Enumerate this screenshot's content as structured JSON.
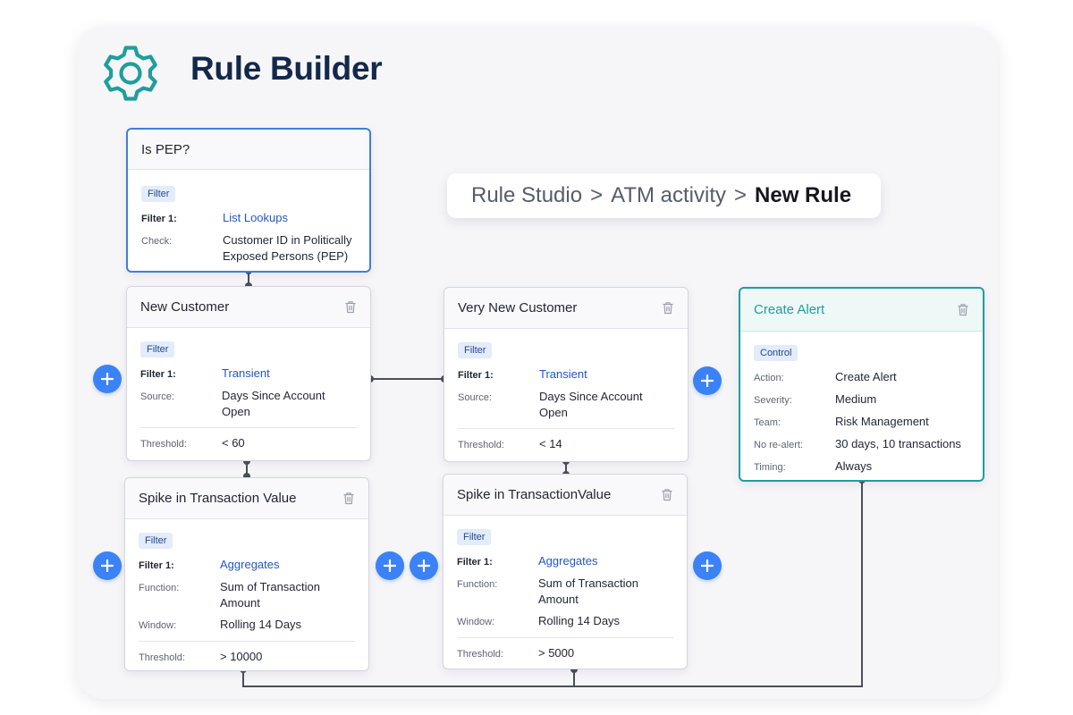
{
  "header": {
    "title": "Rule Builder",
    "icon": "gear-icon",
    "accent": "#1f9e9c"
  },
  "breadcrumb": {
    "items": [
      "Rule Studio",
      "ATM activity"
    ],
    "separator": ">",
    "current": "New Rule"
  },
  "cards": {
    "pep": {
      "title": "Is PEP?",
      "badge": "Filter",
      "rows": [
        {
          "label": "Filter 1:",
          "value": "List Lookups"
        },
        {
          "label": "Check:",
          "value": "Customer ID in Politically Exposed Persons (PEP)"
        }
      ]
    },
    "new_customer": {
      "title": "New Customer",
      "badge": "Filter",
      "rows": [
        {
          "label": "Filter 1:",
          "value": "Transient"
        },
        {
          "label": "Source:",
          "value": "Days Since Account Open"
        },
        {
          "label": "Threshold:",
          "value": "< 60"
        }
      ]
    },
    "spike_1": {
      "title": "Spike in Transaction Value",
      "badge": "Filter",
      "rows": [
        {
          "label": "Filter 1:",
          "value": "Aggregates"
        },
        {
          "label": "Function:",
          "value": "Sum of Transaction Amount"
        },
        {
          "label": "Window:",
          "value": "Rolling 14 Days"
        },
        {
          "label": "Threshold:",
          "value": "> 10000"
        }
      ]
    },
    "very_new_customer": {
      "title": "Very New Customer",
      "badge": "Filter",
      "rows": [
        {
          "label": "Filter 1:",
          "value": "Transient"
        },
        {
          "label": "Source:",
          "value": "Days Since Account Open"
        },
        {
          "label": "Threshold:",
          "value": "< 14"
        }
      ]
    },
    "spike_2": {
      "title": "Spike in TransactionValue",
      "badge": "Filter",
      "rows": [
        {
          "label": "Filter 1:",
          "value": "Aggregates"
        },
        {
          "label": "Function:",
          "value": "Sum of Transaction Amount"
        },
        {
          "label": "Window:",
          "value": "Rolling 14 Days"
        },
        {
          "label": "Threshold:",
          "value": "> 5000"
        }
      ]
    },
    "create_alert": {
      "title": "Create Alert",
      "badge": "Control",
      "rows": [
        {
          "label": "Action:",
          "value": "Create Alert"
        },
        {
          "label": "Severity:",
          "value": "Medium"
        },
        {
          "label": "Team:",
          "value": "Risk Management"
        },
        {
          "label": "No re-alert:",
          "value": "30 days, 10 transactions"
        },
        {
          "label": "Timing:",
          "value": "Always"
        }
      ]
    }
  },
  "colors": {
    "plus_button": "#3b82f6",
    "pep_border": "#3f7fd6",
    "alert_border": "#1f9e9c",
    "title": "#13284a"
  }
}
